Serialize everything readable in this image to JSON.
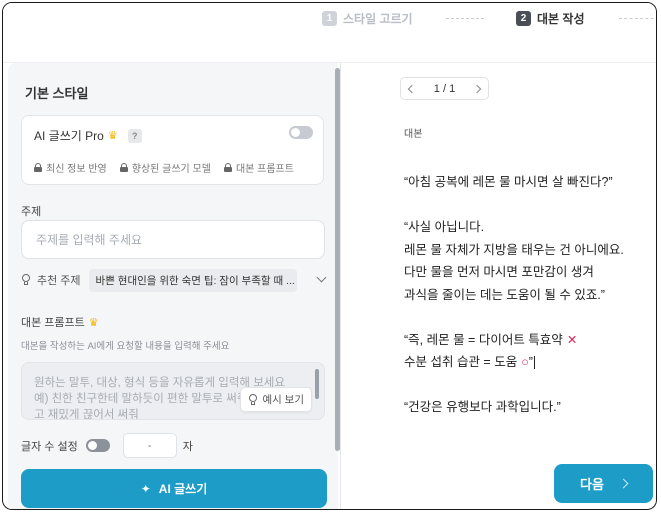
{
  "stepper": {
    "step1": {
      "num": "1",
      "label": "스타일 고르기"
    },
    "step2": {
      "num": "2",
      "label": "대본 작성"
    }
  },
  "left": {
    "title": "기본 스타일",
    "ai_card": {
      "label": "AI 글쓰기 Pro",
      "help": "?",
      "toggle_on": false,
      "features": [
        "최신 정보 반영",
        "향상된 글쓰기 모델",
        "대본 프롬프트"
      ]
    },
    "topic": {
      "label": "주제",
      "placeholder": "주제를 입력해 주세요",
      "value": ""
    },
    "recommended": {
      "label": "추천 주제",
      "value": "바쁜 현대인을 위한 숙면 팁: 잠이 부족할 때 ..."
    },
    "prompt": {
      "label": "대본 프롬프트",
      "description": "대본을 작성하는 AI에게 요청할 내용을 입력해 주세요",
      "placeholder": "원하는 말투, 대상, 형식 등을 자유롭게 입력해 보세요\n예) 친한 친구한테 말하듯이 편한 말투로 써줘. 문장은 짧고 재밌게 끊어서 써줘",
      "example_button": "예시 보기"
    },
    "length": {
      "label": "글자 수 설정",
      "toggle_on": false,
      "value": "-",
      "unit": "자"
    },
    "write_button": "AI 글쓰기"
  },
  "right": {
    "pager": "1 / 1",
    "script_label": "대본",
    "script_lines": [
      "“아침 공복에 레몬 물 마시면 살 빠진다?”",
      "",
      "“사실 아닙니다.",
      "레몬 물 자체가 지방을 태우는 건 아니에요.",
      "다만 물을 먼저 마시면 포만감이 생겨",
      "과식을 줄이는 데는 도움이 될 수 있죠.”",
      "",
      "“즉, 레몬 물 = 다이어트 특효약",
      "수분 섭취 습관 = 도움",
      "",
      "“건강은 유행보다 과학입니다.”"
    ],
    "marks": {
      "x": "✕",
      "o": "○",
      "quote_end": "”"
    },
    "next_button": "다음"
  },
  "colors": {
    "accent": "#1e9cc8",
    "mark": "#e0245e"
  }
}
